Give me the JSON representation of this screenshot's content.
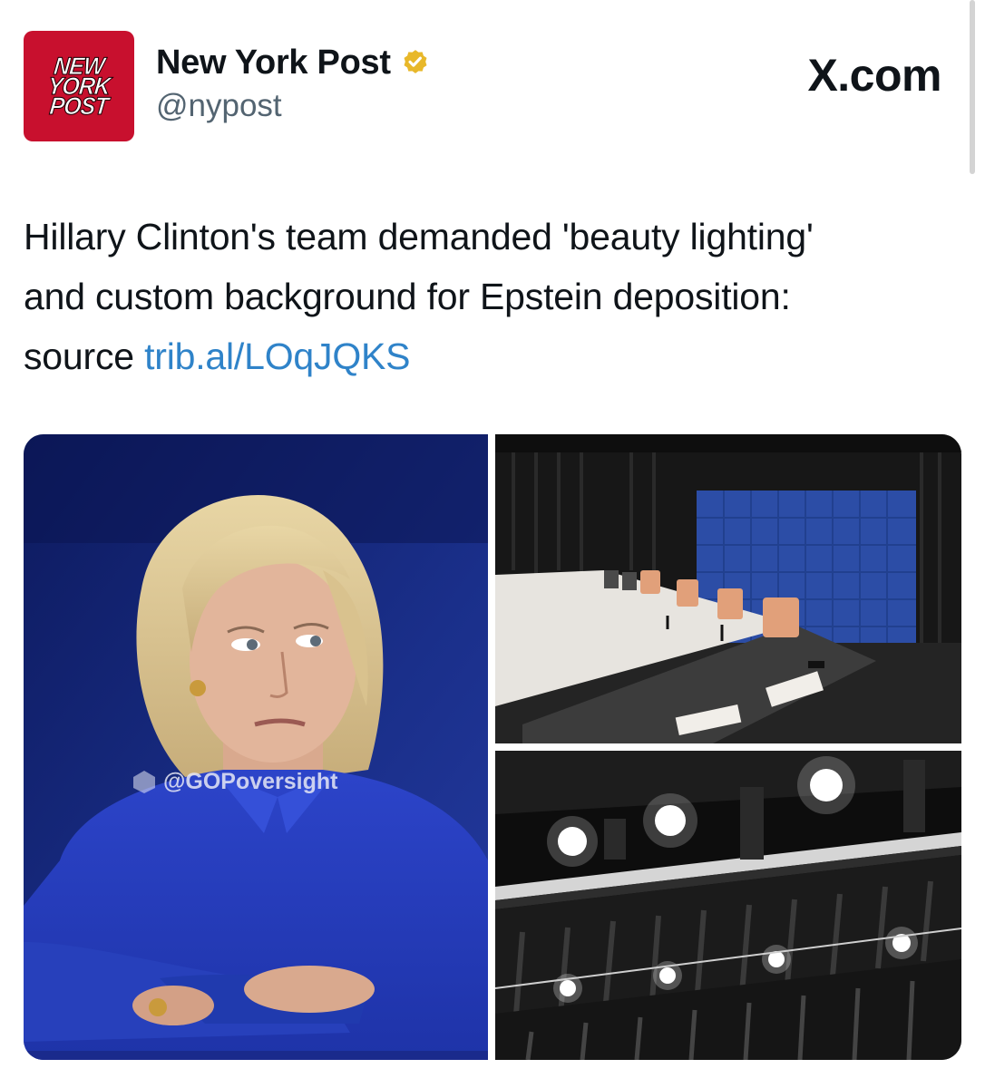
{
  "post": {
    "account": {
      "logo_lines": [
        "NEW",
        "YORK",
        "POST"
      ],
      "name": "New York Post",
      "handle": "@nypost",
      "verified_badge": "verified-badge-icon"
    },
    "site": "X.com",
    "text": {
      "line1": "Hillary Clinton's team demanded 'beauty lighting'",
      "line2": "and custom background for Epstein deposition:",
      "line3_prefix": "source",
      "link": "trib.al/LOqJQKS"
    },
    "media": {
      "watermark": "@GOPoversight"
    }
  },
  "colors": {
    "brand_red": "#c8102e",
    "link_blue": "#2f83c9",
    "verified_gold": "#e8b82a"
  }
}
